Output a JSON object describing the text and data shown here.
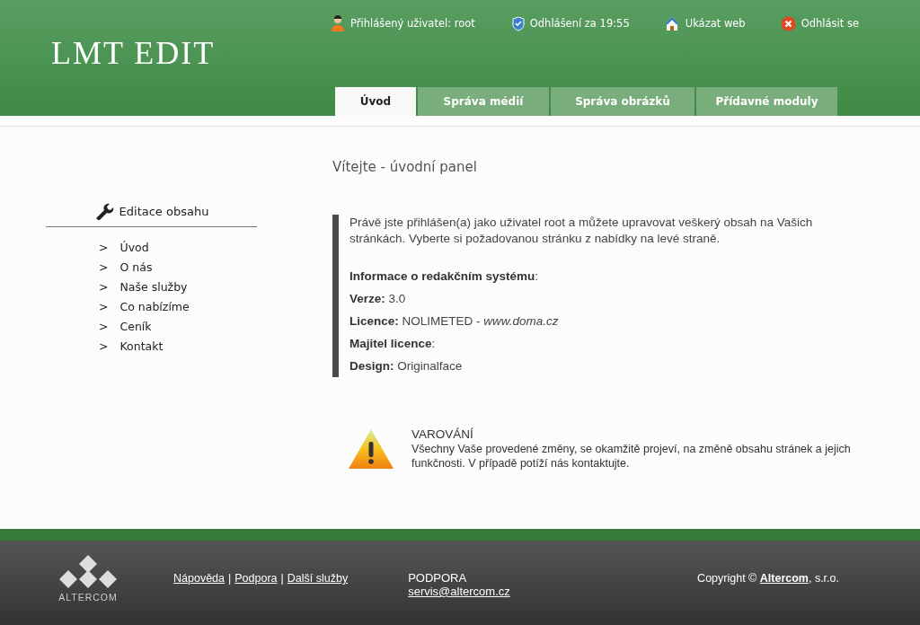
{
  "header": {
    "logo": "LMT EDIT",
    "status": [
      {
        "kind": "user",
        "text": "Přihlášený uživatel: root"
      },
      {
        "kind": "timer",
        "text": "Odhlášení za 19:55"
      },
      {
        "kind": "web",
        "text": "Ukázat web"
      },
      {
        "kind": "logout",
        "text": "Odhlásit se"
      }
    ],
    "tabs": [
      {
        "label": "Úvod",
        "selected": true
      },
      {
        "label": "Správa médií",
        "selected": false
      },
      {
        "label": "Správa obrázků",
        "selected": false
      },
      {
        "label": "Přídavné moduly",
        "selected": false
      }
    ]
  },
  "page_title": "Vítejte - úvodní panel",
  "sidebar": {
    "title": "Editace obsahu",
    "marker": ">",
    "items": [
      "Úvod",
      "O nás",
      "Naše služby",
      "Co nabízíme",
      "Ceník",
      "Kontakt"
    ]
  },
  "intro": "Právě jste přihlášen(a) jako uživatel root a můžete upravovat veškerý obsah na Vašich stránkách. Vyberte si požadovanou stránku z nabídky na levé straně.",
  "info": [
    "**Informace o redakčním systému**:",
    "**Verze:** 3.0",
    "**Licence:** NOLIMETED - *www.doma.cz*",
    "**Majitel licence**:",
    "**Design:** Originalface"
  ],
  "warning": {
    "title": "VAROVÁNÍ",
    "text": "Všechny Vaše provedené změny, se okamžitě projeví, na změně obsahu stránek a jejich funkčnosti. V případě potíží nás kontaktujte."
  },
  "footer": {
    "logo": "ALTERCOM",
    "links": [
      "Nápověda",
      "Podpora",
      "Další služby"
    ],
    "separator": "|",
    "support_title": "PODPORA",
    "support_email": "servis@altercom.cz",
    "copyright_prefix": "Copyright ©",
    "copyright_link": "Altercom",
    "copyright_suffix": ", s.r.o."
  }
}
